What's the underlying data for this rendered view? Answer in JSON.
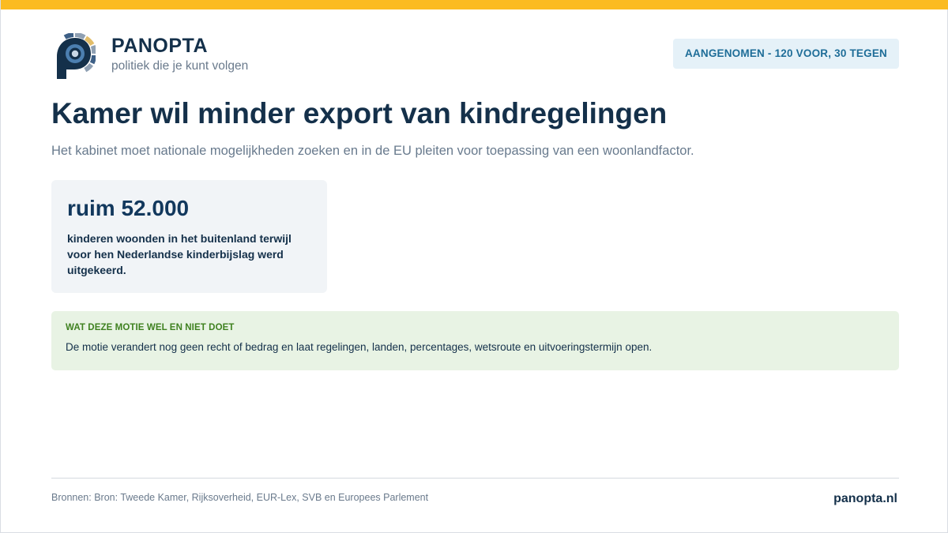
{
  "brand": {
    "name": "PANOPTA",
    "tagline": "politiek die je kunt volgen",
    "accent_color": "#fbbb21",
    "logo_icon": "panopta-eye-logo"
  },
  "badge": {
    "label": "AANGENOMEN - 120 VOOR, 30 TEGEN"
  },
  "article": {
    "title": "Kamer wil minder export van kindregelingen",
    "subtitle": "Het kabinet moet nationale mogelijkheden zoeken en in de EU pleiten voor toepassing van een woonlandfactor."
  },
  "stat": {
    "value": "ruim 52.000",
    "description": "kinderen woonden in het buitenland terwijl voor hen Nederlandse kinderbijslag werd uitgekeerd."
  },
  "note": {
    "heading": "WAT DEZE MOTIE WEL EN NIET DOET",
    "text": "De motie verandert nog geen recht of bedrag en laat regelingen, landen, percentages, wetsroute en uitvoeringstermijn open."
  },
  "footer": {
    "sources": "Bronnen: Bron: Tweede Kamer, Rijksoverheid, EUR-Lex, SVB en Europees Parlement",
    "site": "panopta.nl"
  }
}
